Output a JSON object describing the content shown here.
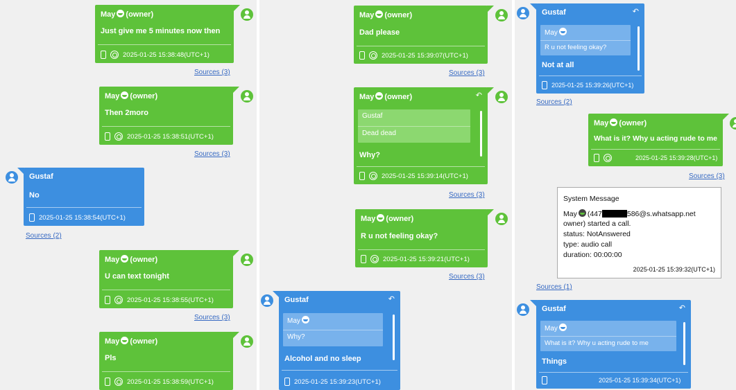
{
  "owner_tag": "(owner)",
  "col1": {
    "m1": {
      "sender": "May",
      "text": "Just give me 5 minutes now then",
      "time": "2025-01-25 15:38:48(UTC+1)",
      "sources": "Sources (3)"
    },
    "m2": {
      "sender": "May",
      "text": "Then 2moro",
      "time": "2025-01-25 15:38:51(UTC+1)",
      "sources": "Sources (3)"
    },
    "m3": {
      "sender": "Gustaf",
      "text": "No",
      "time": "2025-01-25 15:38:54(UTC+1)",
      "sources": "Sources (2)"
    },
    "m4": {
      "sender": "May",
      "text": "U can text tonight",
      "time": "2025-01-25 15:38:55(UTC+1)",
      "sources": "Sources (3)"
    },
    "m5": {
      "sender": "May",
      "text": "Pls",
      "time": "2025-01-25 15:38:59(UTC+1)"
    }
  },
  "col2": {
    "m1": {
      "sender": "May",
      "text": "Dad please",
      "time": "2025-01-25 15:39:07(UTC+1)",
      "sources": "Sources (3)"
    },
    "m2": {
      "sender": "May",
      "quote_sender": "Gustaf",
      "quote_text": "Dead dead",
      "text": "Why?",
      "time": "2025-01-25 15:39:14(UTC+1)",
      "sources": "Sources (3)"
    },
    "m3": {
      "sender": "May",
      "text": "R u not feeling okay?",
      "time": "2025-01-25 15:39:21(UTC+1)",
      "sources": "Sources (3)"
    },
    "m4": {
      "sender": "Gustaf",
      "quote_sender": "May",
      "quote_text": "Why?",
      "text": "Alcohol and no sleep",
      "time": "2025-01-25 15:39:23(UTC+1)"
    }
  },
  "col3": {
    "m1": {
      "sender": "Gustaf",
      "quote_sender": "May",
      "quote_text": "R u not feeling okay?",
      "text": "Not at all",
      "time": "2025-01-25 15:39:26(UTC+1)",
      "sources": "Sources (2)"
    },
    "m2": {
      "sender": "May",
      "text": "What is it? Why u acting rude to me",
      "time": "2025-01-25 15:39:28(UTC+1)",
      "sources": "Sources (3)"
    },
    "sys": {
      "title": "System Message",
      "line1_a": "May",
      "line1_b": "(447",
      "line1_c": "586@s.whatsapp.net",
      "line2": "owner) started a call.",
      "line3": "status: NotAnswered",
      "line4": "type: audio call",
      "line5": "duration: 00:00:00",
      "time": "2025-01-25 15:39:32(UTC+1)",
      "sources": "Sources (1)"
    },
    "m3": {
      "sender": "Gustaf",
      "quote_sender": "May",
      "quote_text": "What is it? Why u acting rude to me",
      "text": "Things",
      "time": "2025-01-25 15:39:34(UTC+1)"
    }
  },
  "colors": {
    "owner_green": "#5ec23a",
    "contact_blue": "#3d8fe0",
    "link_blue": "#3568c2"
  },
  "icons": [
    "user-avatar-icon",
    "phone-icon",
    "group-icon",
    "reply-icon",
    "emoji-icon"
  ]
}
